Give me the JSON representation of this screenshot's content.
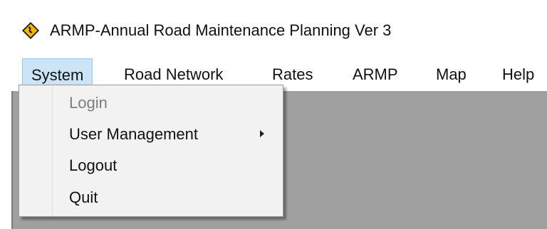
{
  "titlebar": {
    "icon": "road-sign-icon",
    "title": "ARMP-Annual Road Maintenance Planning Ver 3"
  },
  "menubar": {
    "items": [
      {
        "label": "System",
        "active": true
      },
      {
        "label": "Road Network",
        "active": false
      },
      {
        "label": "Rates",
        "active": false
      },
      {
        "label": "ARMP",
        "active": false
      },
      {
        "label": "Map",
        "active": false
      },
      {
        "label": "Help",
        "active": false
      }
    ]
  },
  "dropdown": {
    "items": [
      {
        "label": "Login",
        "disabled": true
      },
      {
        "label": "User Management",
        "submenu": true
      },
      {
        "label": "Logout"
      },
      {
        "label": "Quit"
      }
    ]
  },
  "colors": {
    "active_menu_bg": "#cce4f7",
    "client_bg": "#a0a0a0",
    "dropdown_bg": "#f2f2f2",
    "icon_bg": "#f4b400"
  }
}
